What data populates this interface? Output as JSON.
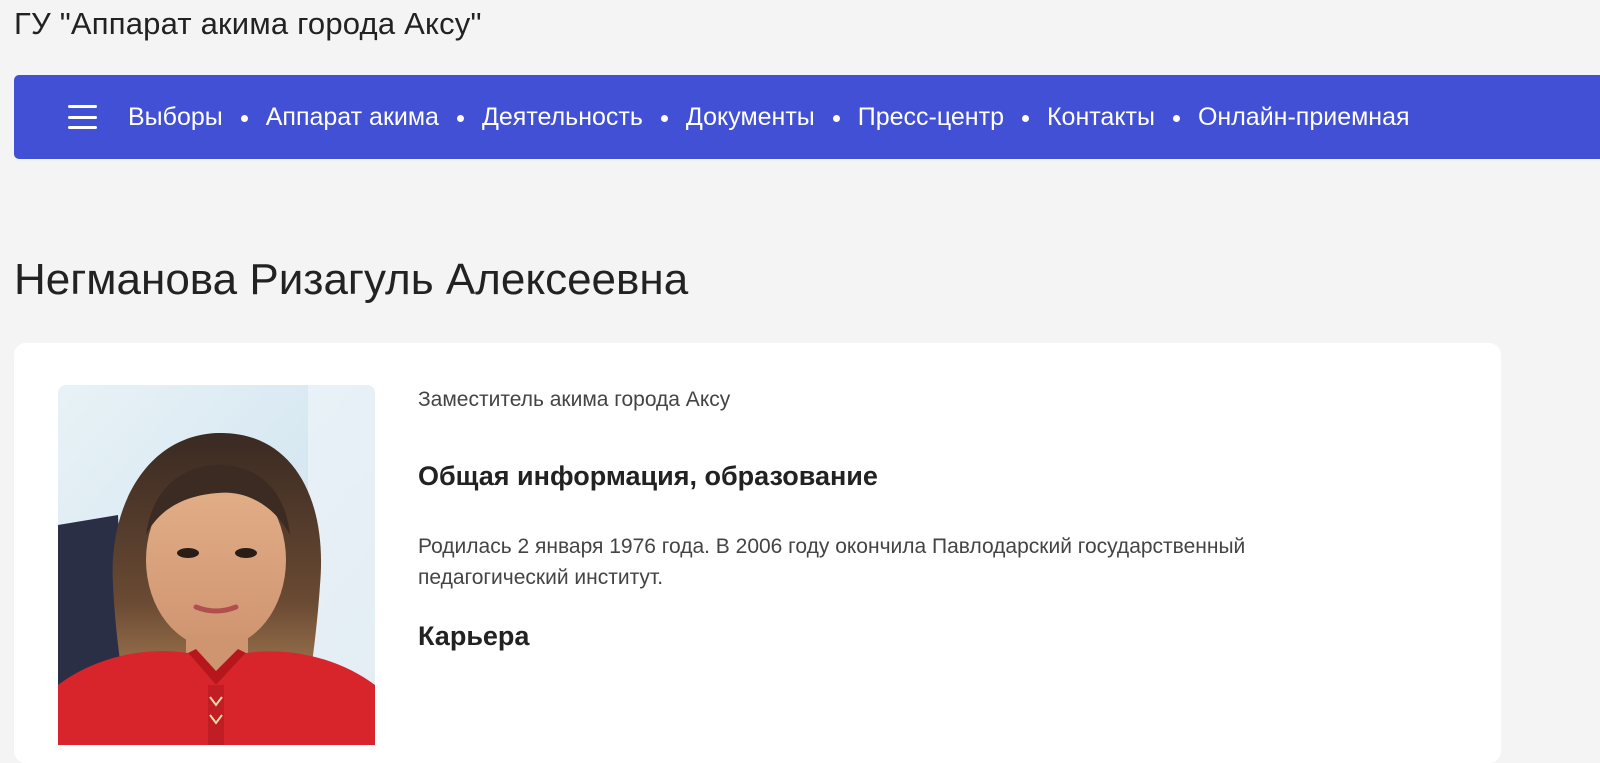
{
  "header": {
    "org_title": "ГУ \"Аппарат акима города Аксу\""
  },
  "nav": {
    "menu_icon": "hamburger-menu-icon",
    "items": [
      {
        "label": "Выборы"
      },
      {
        "label": "Аппарат акима"
      },
      {
        "label": "Деятельность"
      },
      {
        "label": "Документы"
      },
      {
        "label": "Пресс-центр"
      },
      {
        "label": "Контакты"
      },
      {
        "label": "Онлайн-приемная"
      }
    ]
  },
  "profile": {
    "name": "Негманова Ризагуль Алексеевна",
    "position": "Заместитель акима города Аксу",
    "general_heading": "Общая информация, образование",
    "bio": "Родилась 2 января 1976 года. В 2006 году окончила Павлодарский государственный педагогический  институт.",
    "career_heading": "Карьера"
  },
  "colors": {
    "page_bg": "#f4f4f4",
    "nav_bg": "#4150d4",
    "card_bg": "#ffffff",
    "jacket_red": "#d8242b"
  }
}
